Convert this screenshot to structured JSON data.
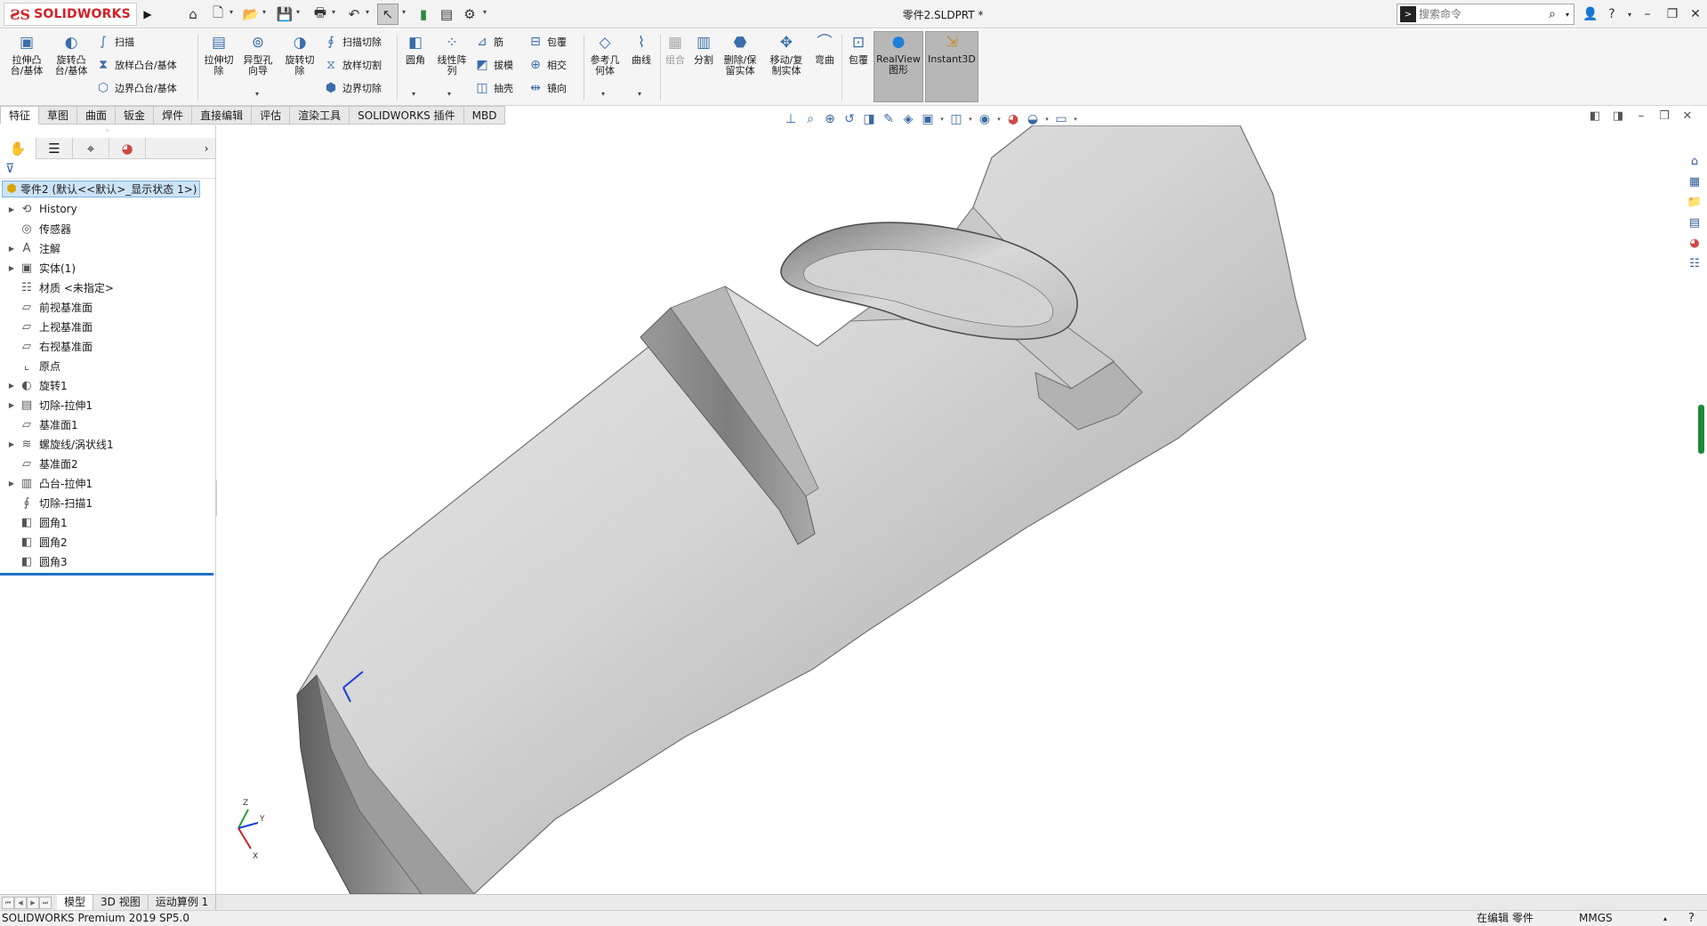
{
  "app": {
    "brand": "SOLIDWORKS",
    "doc_title": "零件2.SLDPRT *",
    "search_placeholder": "搜索命令"
  },
  "ribbon": {
    "buttons": {
      "extrude_boss": "拉伸凸\n台/基体",
      "revolve_boss": "旋转凸\n台/基体",
      "sweep": "扫描",
      "loft": "放样凸台/基体",
      "boundary": "边界凸台/基体",
      "extrude_cut": "拉伸切\n除",
      "hole_wizard": "异型孔\n向导",
      "revolve_cut": "旋转切\n除",
      "swept_cut": "扫描切除",
      "lofted_cut": "放样切割",
      "boundary_cut": "边界切除",
      "fillet": "圆角",
      "linear_pattern": "线性阵\n列",
      "rib": "筋",
      "draft": "拔模",
      "shell": "抽壳",
      "wrap": "包覆",
      "intersect": "相交",
      "mirror": "镜向",
      "ref_geometry": "参考几\n何体",
      "curves": "曲线",
      "combine": "组合",
      "split": "分割",
      "delete_body": "删除/保\n留实体",
      "move_copy": "移动/复\n制实体",
      "flex": "弯曲",
      "wrap2": "包覆",
      "realview": "RealView\n图形",
      "instant3d": "Instant3D"
    }
  },
  "tabs": [
    "特征",
    "草图",
    "曲面",
    "钣金",
    "焊件",
    "直接编辑",
    "评估",
    "渲染工具",
    "SOLIDWORKS 插件",
    "MBD"
  ],
  "feature_tree": {
    "root": "零件2 (默认<<默认>_显示状态 1>)",
    "items": [
      {
        "label": "History",
        "expandable": true,
        "icon": "history-icon"
      },
      {
        "label": "传感器",
        "expandable": false,
        "icon": "sensor-icon"
      },
      {
        "label": "注解",
        "expandable": true,
        "icon": "annotation-icon"
      },
      {
        "label": "实体(1)",
        "expandable": true,
        "icon": "solid-bodies-icon"
      },
      {
        "label": "材质 <未指定>",
        "expandable": false,
        "icon": "material-icon"
      },
      {
        "label": "前视基准面",
        "expandable": false,
        "icon": "plane-icon"
      },
      {
        "label": "上视基准面",
        "expandable": false,
        "icon": "plane-icon"
      },
      {
        "label": "右视基准面",
        "expandable": false,
        "icon": "plane-icon"
      },
      {
        "label": "原点",
        "expandable": false,
        "icon": "origin-icon"
      },
      {
        "label": "旋转1",
        "expandable": true,
        "icon": "revolve-icon"
      },
      {
        "label": "切除-拉伸1",
        "expandable": true,
        "icon": "cut-extrude-icon"
      },
      {
        "label": "基准面1",
        "expandable": false,
        "icon": "plane-icon"
      },
      {
        "label": "螺旋线/涡状线1",
        "expandable": true,
        "icon": "helix-icon"
      },
      {
        "label": "基准面2",
        "expandable": false,
        "icon": "plane-icon"
      },
      {
        "label": "凸台-拉伸1",
        "expandable": true,
        "icon": "boss-extrude-icon"
      },
      {
        "label": "切除-扫描1",
        "expandable": false,
        "icon": "cut-sweep-icon"
      },
      {
        "label": "圆角1",
        "expandable": false,
        "icon": "fillet-icon"
      },
      {
        "label": "圆角2",
        "expandable": false,
        "icon": "fillet-icon"
      },
      {
        "label": "圆角3",
        "expandable": false,
        "icon": "fillet-icon"
      }
    ]
  },
  "bottom_tabs": [
    "模型",
    "3D 视图",
    "运动算例 1"
  ],
  "status": {
    "left": "SOLIDWORKS Premium 2019 SP5.0",
    "editing": "在编辑 零件",
    "units": "MMGS"
  },
  "colors": {
    "brand_red": "#d51f26",
    "selection_blue": "#cde4f7",
    "accent_blue": "#1e73c8"
  }
}
